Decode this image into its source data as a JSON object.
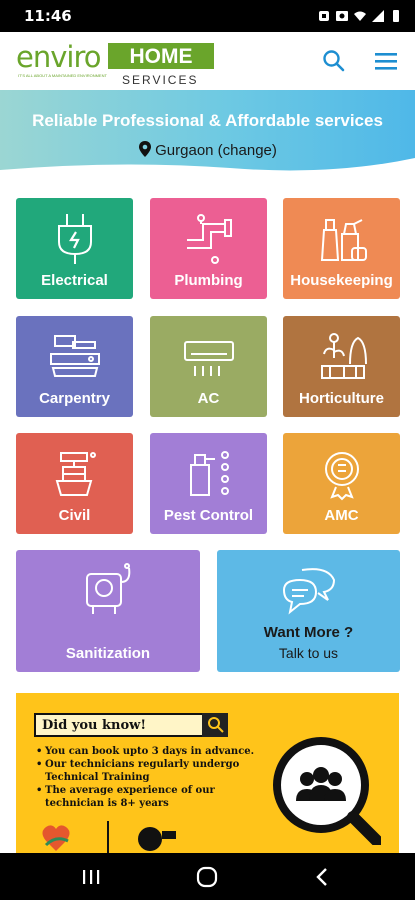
{
  "status_bar": {
    "time": "11:46"
  },
  "header": {
    "logo_main": "enviro",
    "logo_tagline": "IT'S ALL ABOUT A MAINTAINED ENVIRONMENT",
    "logo_home": "HOME",
    "logo_services": "SERVICES"
  },
  "hero": {
    "tagline": "Reliable Professional & Affordable services",
    "location": "Gurgaon (change)"
  },
  "tiles": [
    {
      "label": "Electrical",
      "color": "#21a87b",
      "icon": "plug-icon"
    },
    {
      "label": "Plumbing",
      "color": "#ec5f93",
      "icon": "pipe-icon"
    },
    {
      "label": "Housekeeping",
      "color": "#ef8a54",
      "icon": "cleaning-supplies-icon"
    },
    {
      "label": "Carpentry",
      "color": "#6a72be",
      "icon": "saw-icon"
    },
    {
      "label": "AC",
      "color": "#9aab63",
      "icon": "air-conditioner-icon"
    },
    {
      "label": "Horticulture",
      "color": "#b07440",
      "icon": "plant-icon"
    },
    {
      "label": "Civil",
      "color": "#e06052",
      "icon": "construction-icon"
    },
    {
      "label": "Pest Control",
      "color": "#a27ed6",
      "icon": "spray-icon"
    },
    {
      "label": "AMC",
      "color": "#eca43a",
      "icon": "contract-icon"
    }
  ],
  "sanitization": {
    "label": "Sanitization",
    "color": "#a27ed6",
    "icon": "sanitizer-machine-icon"
  },
  "want_more": {
    "line1": "Want More ?",
    "line2": "Talk to us",
    "color": "#5db9e6",
    "icon": "chat-bubbles-icon"
  },
  "banner": {
    "title": "Did you know!",
    "bullets": [
      "You can book upto 3 days in advance.",
      "Our technicians regularly undergo Technical Training",
      "The average experience of our technician is 8+ years"
    ],
    "background": "#ffc41a"
  }
}
